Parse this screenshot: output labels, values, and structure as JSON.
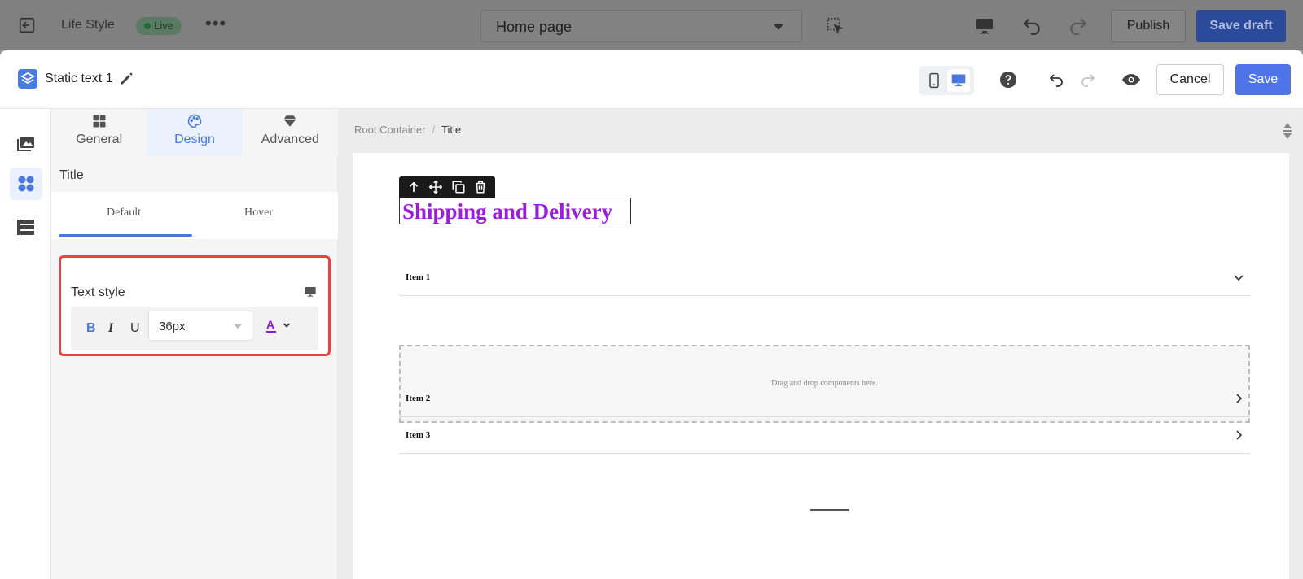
{
  "background_bar": {
    "site_name": "Life Style",
    "live_badge": "Live",
    "more": "•••",
    "page_select": "Home page",
    "publish": "Publish",
    "save_draft": "Save draft"
  },
  "editor": {
    "title": "Static text 1",
    "cancel": "Cancel",
    "save": "Save"
  },
  "panel": {
    "tabs": [
      {
        "label": "General",
        "icon": "grid-icon"
      },
      {
        "label": "Design",
        "icon": "palette-icon"
      },
      {
        "label": "Advanced",
        "icon": "diamond-icon"
      }
    ],
    "section_title": "Title",
    "state_tabs": [
      "Default",
      "Hover"
    ],
    "text_style": {
      "label": "Text style",
      "bold": "B",
      "italic": "I",
      "underline": "U",
      "font_size": "36px",
      "color_letter": "A",
      "color": "#8b1ad4"
    }
  },
  "canvas": {
    "breadcrumb": {
      "root": "Root Container",
      "separator": "/",
      "current": "Title"
    },
    "heading": "Shipping and Delivery",
    "heading_color": "#9b1fd8",
    "accordion": [
      {
        "label": "Item 1",
        "expanded": true
      },
      {
        "label": "Item 2",
        "expanded": false
      },
      {
        "label": "Item 3",
        "expanded": false
      }
    ],
    "dropzone_text": "Drag and drop components here."
  },
  "colors": {
    "accent": "#4f73e8",
    "highlight": "#e9453d"
  }
}
